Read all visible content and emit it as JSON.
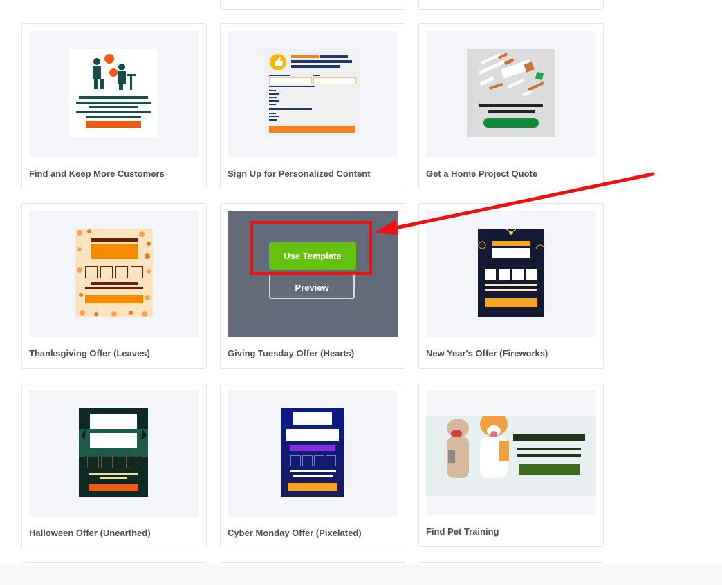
{
  "cards": [
    {
      "title": "Find and Keep More Customers"
    },
    {
      "title": "Sign Up for Personalized Content"
    },
    {
      "title": "Get a Home Project Quote"
    },
    {
      "title": "Thanksgiving Offer (Leaves)"
    },
    {
      "title": "Giving Tuesday Offer (Hearts)"
    },
    {
      "title": "New Year's Offer (Fireworks)"
    },
    {
      "title": "Halloween Offer (Unearthed)"
    },
    {
      "title": "Cyber Monday Offer (Pixelated)"
    },
    {
      "title": "Find Pet Training"
    }
  ],
  "hover_card": {
    "use_template_label": "Use Template",
    "preview_label": "Preview"
  },
  "colors": {
    "accent_green": "#65c10f",
    "annotation_red": "#ee1111",
    "overlay_gray": "#636a79"
  }
}
